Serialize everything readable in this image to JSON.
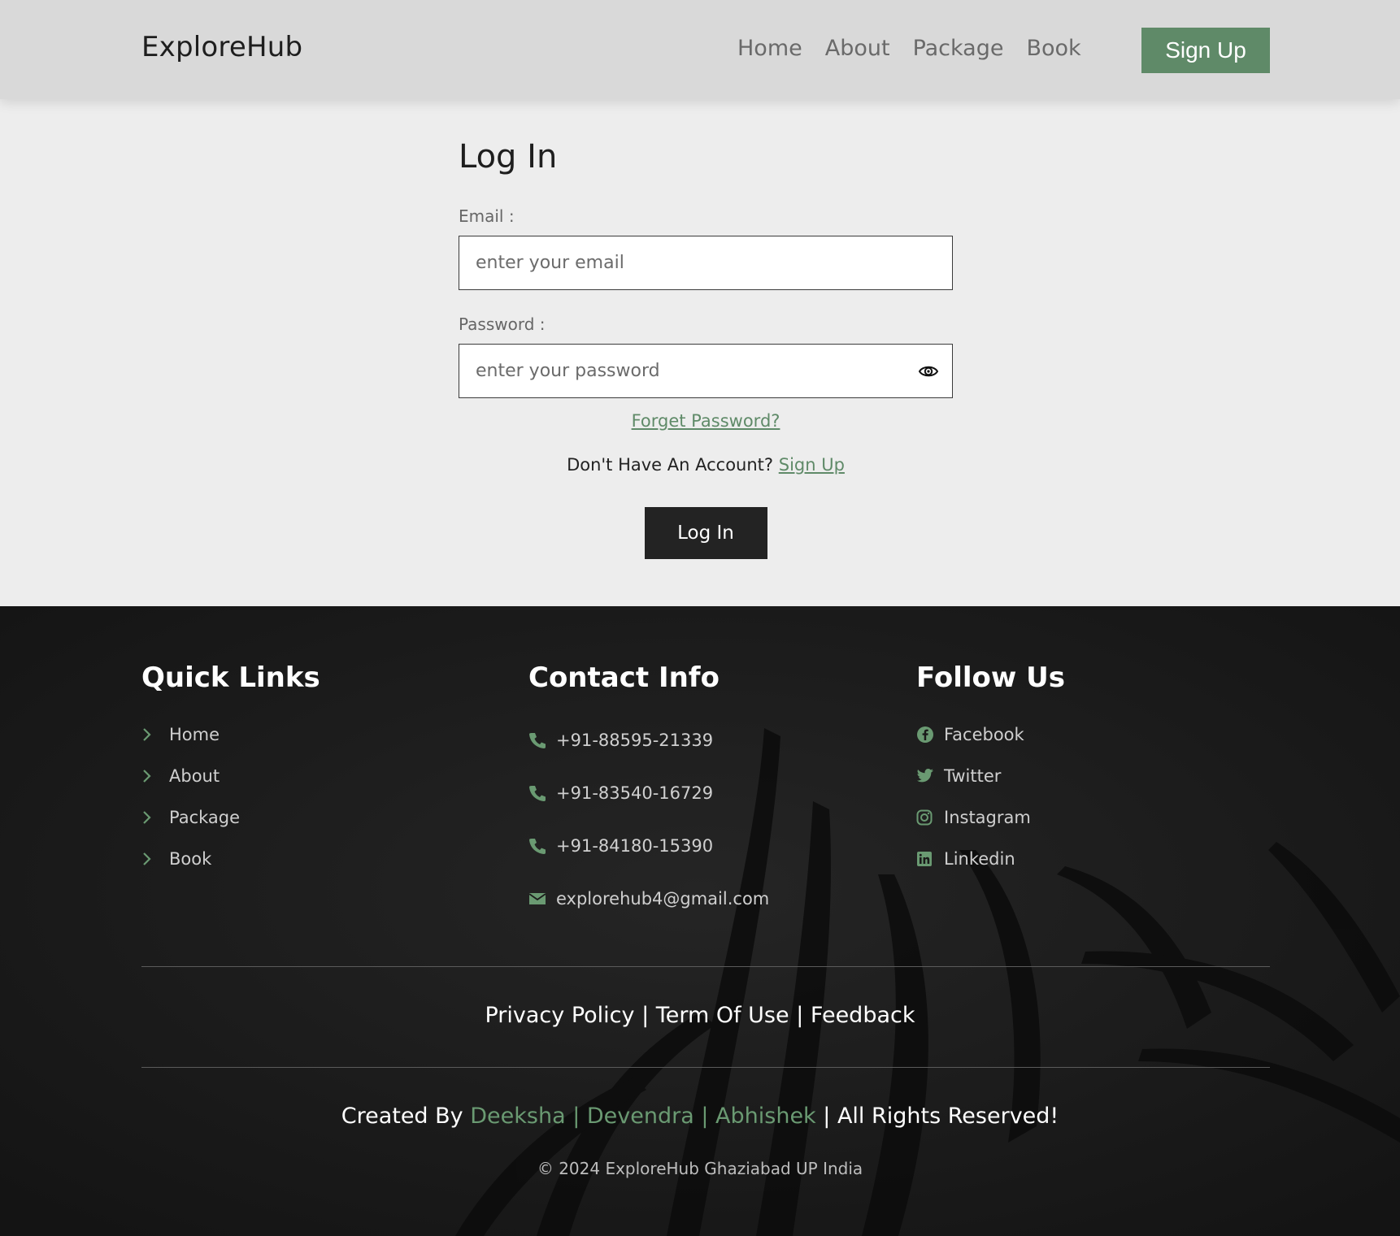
{
  "brand": "ExploreHub",
  "nav": {
    "items": [
      "Home",
      "About",
      "Package",
      "Book"
    ],
    "signup_label": "Sign Up"
  },
  "login": {
    "title": "Log In",
    "email_label": "Email :",
    "email_placeholder": "enter your email",
    "password_label": "Password :",
    "password_placeholder": "enter your password",
    "forgot_label": "Forget Password?",
    "no_account_text": "Don't Have An Account?",
    "signup_link": "Sign Up",
    "submit_label": "Log In"
  },
  "footer": {
    "quick_links": {
      "title": "Quick Links",
      "items": [
        "Home",
        "About",
        "Package",
        "Book"
      ]
    },
    "contact": {
      "title": "Contact Info",
      "items": [
        "+91-88595-21339",
        "+91-83540-16729",
        "+91-84180-15390",
        "explorehub4@gmail.com"
      ]
    },
    "follow": {
      "title": "Follow Us",
      "items": [
        "Facebook",
        "Twitter",
        "Instagram",
        "Linkedin"
      ]
    },
    "legal": {
      "privacy": "Privacy Policy",
      "terms": "Term Of Use",
      "feedback": "Feedback",
      "separator": "|"
    },
    "credits": {
      "prefix": "Created By",
      "authors": "Deeksha | Devendra | Abhishek",
      "suffix": "| All Rights Reserved!"
    },
    "copyright": "© 2024 ExploreHub Ghaziabad UP India"
  },
  "colors": {
    "accent": "#5f8a68",
    "header_bg": "#d9d9d9",
    "page_bg": "#ededed",
    "footer_bg": "#1a1a1a",
    "button_dark": "#232323"
  },
  "icons": {
    "quick_links": "chevron-right-icon",
    "contact": [
      "phone-icon",
      "phone-icon",
      "phone-icon",
      "envelope-icon"
    ],
    "follow": [
      "facebook-icon",
      "twitter-icon",
      "instagram-icon",
      "linkedin-icon"
    ],
    "password_toggle": "eye-icon"
  }
}
